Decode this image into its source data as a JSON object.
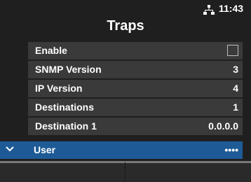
{
  "status": {
    "network_icon": "network-icon",
    "time": "11:43"
  },
  "title": "Traps",
  "menu": {
    "items": [
      {
        "label": "Enable",
        "value": "",
        "control": "checkbox",
        "checked": false
      },
      {
        "label": "SNMP Version",
        "value": "3"
      },
      {
        "label": "IP Version",
        "value": "4"
      },
      {
        "label": "Destinations",
        "value": "1"
      },
      {
        "label": "Destination 1",
        "value": "0.0.0.0"
      },
      {
        "label": "User",
        "value": "••••",
        "selected": true,
        "expand_icon": "chevron-down-icon"
      }
    ]
  },
  "colors": {
    "background": "#1f1f1f",
    "row": "#3a3a3a",
    "selected_row": "#1e5b96",
    "text": "#ffffff"
  },
  "softkeys": {
    "left": "",
    "right": ""
  }
}
